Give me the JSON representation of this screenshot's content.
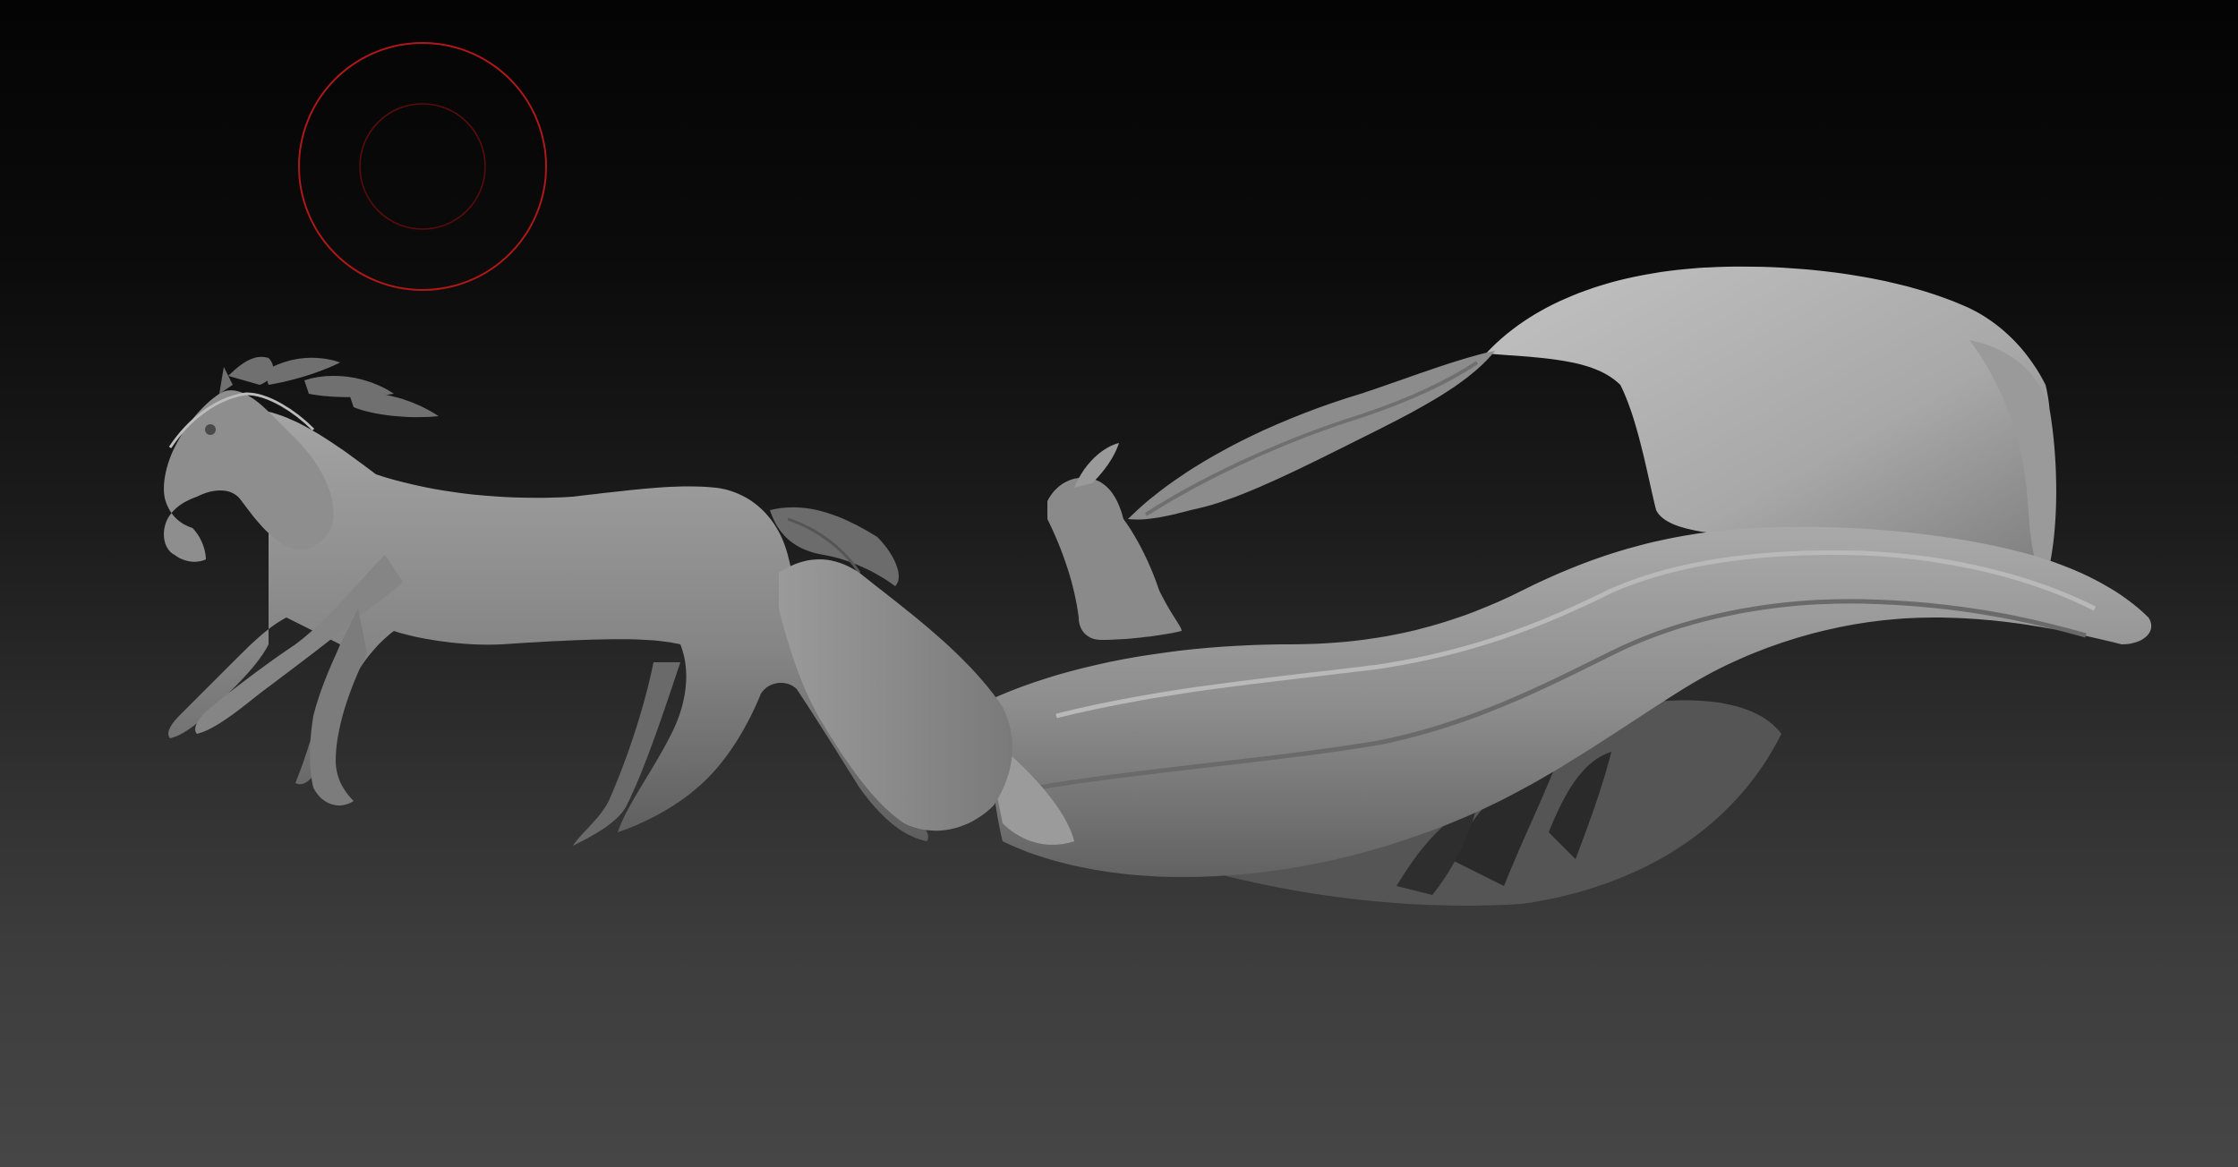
{
  "canvas": {
    "background_top": "#040404",
    "background_bottom": "#464646",
    "model_color": "#8a8a8a"
  },
  "brush_cursor": {
    "outer_color": "#b01818",
    "inner_color": "#5a0c0c",
    "icon": "brush-radius-icon"
  },
  "model": {
    "icon": "sculpted-mesh-icon",
    "parts": [
      "horse",
      "mane",
      "rider",
      "sleigh",
      "cloth",
      "sack"
    ]
  }
}
